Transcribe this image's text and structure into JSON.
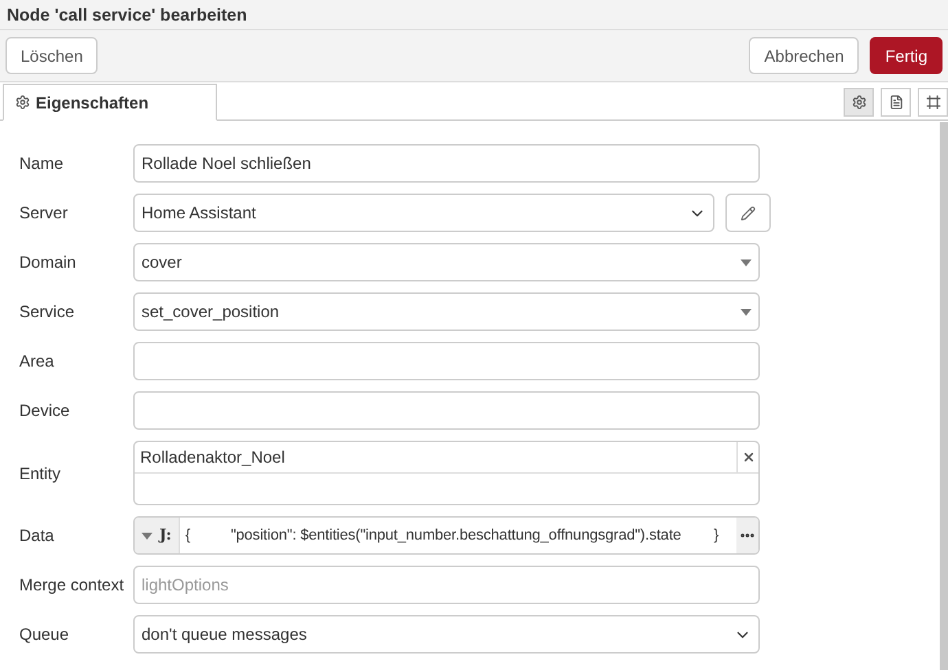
{
  "dialog": {
    "title": "Node 'call service' bearbeiten"
  },
  "buttons": [
    {
      "label": "Löschen",
      "kind": "plain"
    },
    {
      "label": "Abbrechen",
      "kind": "plain"
    },
    {
      "label": "Fertig",
      "kind": "primary"
    }
  ],
  "tabs": [
    {
      "label": "Eigenschaften",
      "selected": true
    }
  ],
  "side_tabs": [
    {
      "kind": "settings",
      "selected": true
    },
    {
      "kind": "description",
      "selected": false
    },
    {
      "kind": "appearance",
      "selected": false
    }
  ],
  "fields": [
    {
      "label": "Name",
      "kind": "text",
      "value": "Rollade Noel schließen"
    },
    {
      "label": "Server",
      "kind": "select",
      "value": "Home Assistant",
      "edit_button": true
    },
    {
      "label": "Domain",
      "kind": "combo",
      "value": "cover"
    },
    {
      "label": "Service",
      "kind": "combo",
      "value": "set_cover_position"
    },
    {
      "label": "Area",
      "kind": "text"
    },
    {
      "label": "Device",
      "kind": "text"
    },
    {
      "label": "Entity",
      "kind": "tags",
      "tags": [
        "Rolladenaktor_Noel"
      ]
    },
    {
      "label": "Data",
      "kind": "expression",
      "type_label": "J:",
      "value": "{          \"position\": $entities(\"input_number.beschattung_offnungsgrad\").state        }"
    },
    {
      "label": "Merge context",
      "kind": "text",
      "placeholder": "lightOptions"
    },
    {
      "label": "Queue",
      "kind": "select",
      "value": "don't queue messages"
    }
  ]
}
